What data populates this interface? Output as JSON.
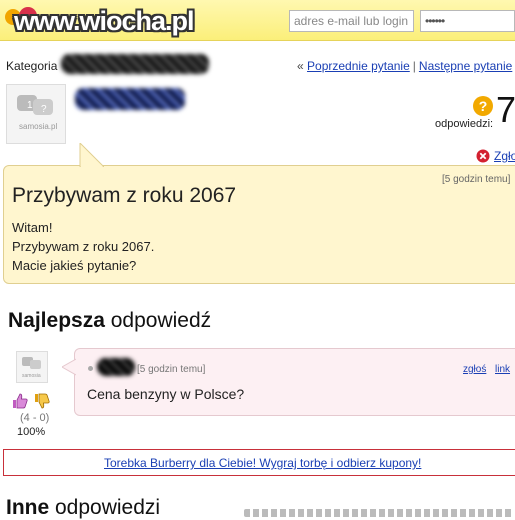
{
  "header": {
    "logo_text": "www.wiocha.pl",
    "email_placeholder": "adres e-mail lub login",
    "password_mask": "••••••"
  },
  "breadcrumb": {
    "category_label": "Kategoria",
    "prev_arrow": "«",
    "prev_link": "Poprzednie pytanie",
    "separator": "|",
    "next_link": "Następne pytanie"
  },
  "question": {
    "answers_label": "odpowiedzi:",
    "answers_count": "7",
    "report_label": "Zgło",
    "time": "[5 godzin temu]",
    "title": "Przybywam z roku 2067",
    "body_lines": [
      "Witam!",
      "Przybywam z roku 2067.",
      "Macie jakieś pytanie?"
    ]
  },
  "best_answer": {
    "heading_bold": "Najlepsza",
    "heading_rest": " odpowiedź",
    "time": "[5 godzin temu]",
    "report_link": "zgłoś",
    "link_label": "link",
    "text": "Cena benzyny w Polsce?",
    "votes": "(4 - 0)",
    "percent": "100%"
  },
  "ad": {
    "text": "Torebka Burberry dla Ciebie! Wygraj torbę i odbierz kupony!"
  },
  "other_answers": {
    "heading_bold": "Inne",
    "heading_rest": " odpowiedzi"
  },
  "colors": {
    "topbar": "#fbef7a",
    "question_bg": "#fff6cf",
    "answer_bg": "#fdf0f3",
    "link": "#1a3fb4",
    "ad_border": "#c8303a"
  }
}
